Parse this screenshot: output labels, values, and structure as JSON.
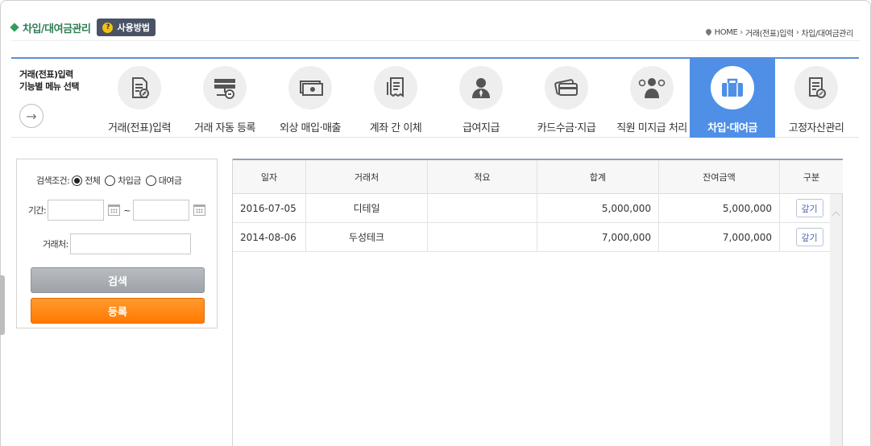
{
  "page": {
    "title": "차입/대여금관리",
    "help_label": "사용방법",
    "help_mark": "?"
  },
  "breadcrumb": [
    "HOME",
    "거래(전표)입력",
    "차입/대여금관리"
  ],
  "menu": {
    "intro_line1": "거래(전표)입력",
    "intro_line2": "기능별 메뉴 선택",
    "items": [
      {
        "label": "거래(전표)입력",
        "icon": "voucher-edit-icon"
      },
      {
        "label": "거래 자동 등록",
        "icon": "network-auto-icon"
      },
      {
        "label": "외상 매입·매출",
        "icon": "cash-receivable-icon"
      },
      {
        "label": "계좌 간 이체",
        "icon": "receipt-transfer-icon"
      },
      {
        "label": "급여지급",
        "icon": "employee-icon"
      },
      {
        "label": "카드수금·지급",
        "icon": "card-icon"
      },
      {
        "label": "직원 미지급 처리",
        "icon": "businessman-icon"
      },
      {
        "label": "차입·대여금",
        "icon": "briefcase-icon",
        "active": true
      },
      {
        "label": "고정자산관리",
        "icon": "asset-document-icon"
      }
    ],
    "accent_color": "#4f8fe6"
  },
  "search": {
    "condition_label": "검색조건:",
    "options": [
      {
        "label": "전체",
        "checked": true
      },
      {
        "label": "차입금",
        "checked": false
      },
      {
        "label": "대여금",
        "checked": false
      }
    ],
    "period_label": "기간:",
    "period_separator": "~",
    "period_from": "",
    "period_to": "",
    "client_label": "거래처:",
    "client_value": "",
    "search_button": "검색",
    "register_button": "등록"
  },
  "table": {
    "headers": [
      "일자",
      "거래처",
      "적요",
      "합계",
      "잔여금액",
      "구분"
    ],
    "rows": [
      {
        "date": "2016-07-05",
        "client": "디테일",
        "memo": "",
        "total": "5,000,000",
        "remaining": "5,000,000",
        "action": "갚기"
      },
      {
        "date": "2014-08-06",
        "client": "두성테크",
        "memo": "",
        "total": "7,000,000",
        "remaining": "7,000,000",
        "action": "갚기"
      }
    ]
  }
}
